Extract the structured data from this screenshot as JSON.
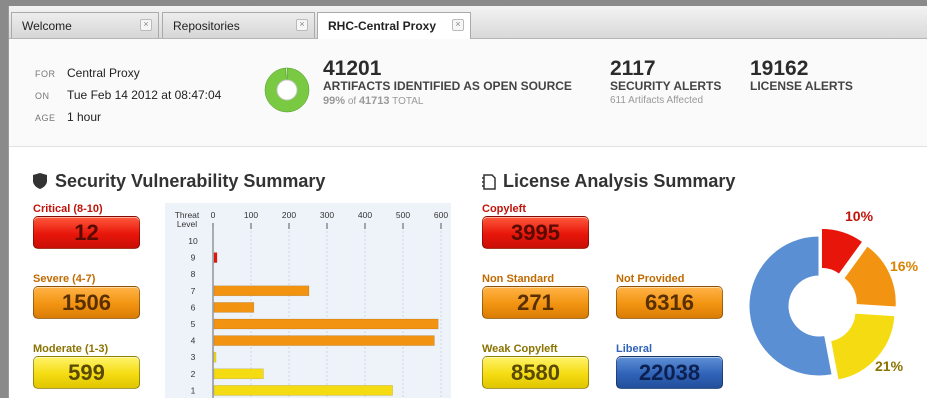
{
  "tabs": [
    {
      "label": "Welcome"
    },
    {
      "label": "Repositories"
    },
    {
      "label": "RHC-Central Proxy"
    }
  ],
  "header": {
    "for_key": "FOR",
    "for_value": "Central Proxy",
    "on_key": "ON",
    "on_value": "Tue Feb 14 2012 at 08:47:04",
    "age_key": "AGE",
    "age_value": "1 hour",
    "artifacts_count": "41201",
    "artifacts_label": "ARTIFACTS IDENTIFIED AS OPEN SOURCE",
    "artifacts_pct": "99%",
    "artifacts_of": "of",
    "artifacts_total": "41713",
    "artifacts_total_label": "TOTAL",
    "security_count": "2117",
    "security_label": "SECURITY ALERTS",
    "security_sub": "611 Artifacts Affected",
    "license_count": "19162",
    "license_label": "LICENSE ALERTS"
  },
  "security": {
    "title": "Security Vulnerability Summary",
    "critical_label": "Critical (8-10)",
    "critical_value": "12",
    "severe_label": "Severe (4-7)",
    "severe_value": "1506",
    "moderate_label": "Moderate (1-3)",
    "moderate_value": "599"
  },
  "license": {
    "title": "License Analysis Summary",
    "copyleft_label": "Copyleft",
    "copyleft_value": "3995",
    "nonstandard_label": "Non Standard",
    "nonstandard_value": "271",
    "notprovided_label": "Not Provided",
    "notprovided_value": "6316",
    "weak_label": "Weak Copyleft",
    "weak_value": "8580",
    "liberal_label": "Liberal",
    "liberal_value": "22038"
  },
  "colors": {
    "red": "#e8160a",
    "orange": "#f29411",
    "yellow": "#f5dc12",
    "blue": "#2f63b8",
    "green": "#7ac943",
    "pie_blue": "#5b8fd4"
  },
  "chart_data": [
    {
      "type": "bar",
      "orientation": "horizontal",
      "ylabel": "Threat Level",
      "categories": [
        "10",
        "9",
        "8",
        "7",
        "6",
        "5",
        "4",
        "3",
        "2",
        "1"
      ],
      "values": [
        0,
        8,
        0,
        250,
        105,
        590,
        580,
        5,
        130,
        470
      ],
      "category_colors": [
        "#e8160a",
        "#e8160a",
        "#f29411",
        "#f29411",
        "#f29411",
        "#f29411",
        "#f29411",
        "#f5dc12",
        "#f5dc12",
        "#f5dc12"
      ],
      "xticks": [
        "0",
        "100",
        "200",
        "300",
        "400",
        "500",
        "600"
      ],
      "xlim": [
        0,
        600
      ]
    },
    {
      "type": "pie",
      "donut": true,
      "slices": [
        {
          "label": "10%",
          "value": 10,
          "color": "#e8160a"
        },
        {
          "label": "16%",
          "value": 16,
          "color": "#f29411"
        },
        {
          "label": "21%",
          "value": 21,
          "color": "#f5dc12"
        },
        {
          "label": "",
          "value": 53,
          "color": "#5b8fd4"
        }
      ]
    },
    {
      "type": "pie",
      "donut": true,
      "slices": [
        {
          "label": "",
          "value": 99,
          "color": "#7ac943"
        },
        {
          "label": "",
          "value": 1,
          "color": "#ffffff"
        }
      ]
    }
  ]
}
